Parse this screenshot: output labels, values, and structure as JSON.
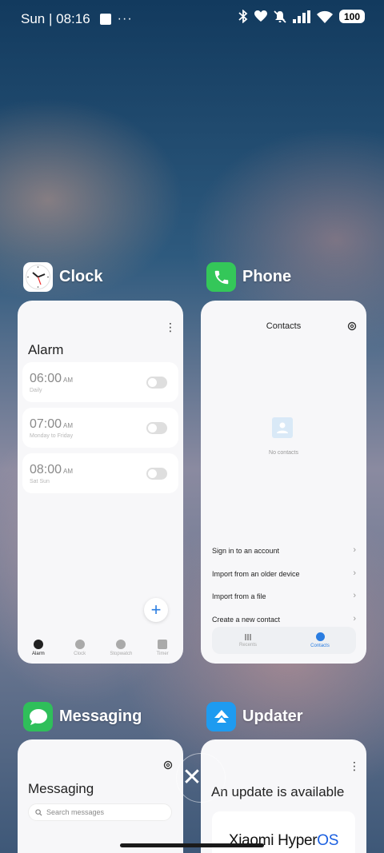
{
  "status_bar": {
    "time": "Sun | 08:16",
    "more": "···",
    "battery": "100"
  },
  "apps": {
    "clock": {
      "name": "Clock",
      "screen_title": "Alarm",
      "alarms": [
        {
          "time": "06:00",
          "ampm": "AM",
          "repeat": "Daily"
        },
        {
          "time": "07:00",
          "ampm": "AM",
          "repeat": "Monday to Friday"
        },
        {
          "time": "08:00",
          "ampm": "AM",
          "repeat": "Sat Sun"
        }
      ],
      "add_button": "+",
      "nav": [
        "Alarm",
        "Clock",
        "Stopwatch",
        "Timer"
      ]
    },
    "phone": {
      "name": "Phone",
      "screen_title": "Contacts",
      "empty_text": "No contacts",
      "actions": [
        "Sign in to an account",
        "Import from an older device",
        "Import from a file",
        "Create a new contact"
      ],
      "nav": [
        "Recents",
        "Contacts"
      ]
    },
    "messaging": {
      "name": "Messaging",
      "screen_title": "Messaging",
      "search_placeholder": "Search messages"
    },
    "updater": {
      "name": "Updater",
      "screen_title": "An update is available",
      "brand": "Xiaomi Hyper",
      "brand_suffix": "OS"
    }
  },
  "close_all_label": "✕",
  "colors": {
    "accent": "#2a7de1",
    "card_bg": "#f7f7f9",
    "phone_icon": "#34c759",
    "messaging_icon": "#2fbf5a",
    "updater_icon": "#1e9bf0"
  }
}
